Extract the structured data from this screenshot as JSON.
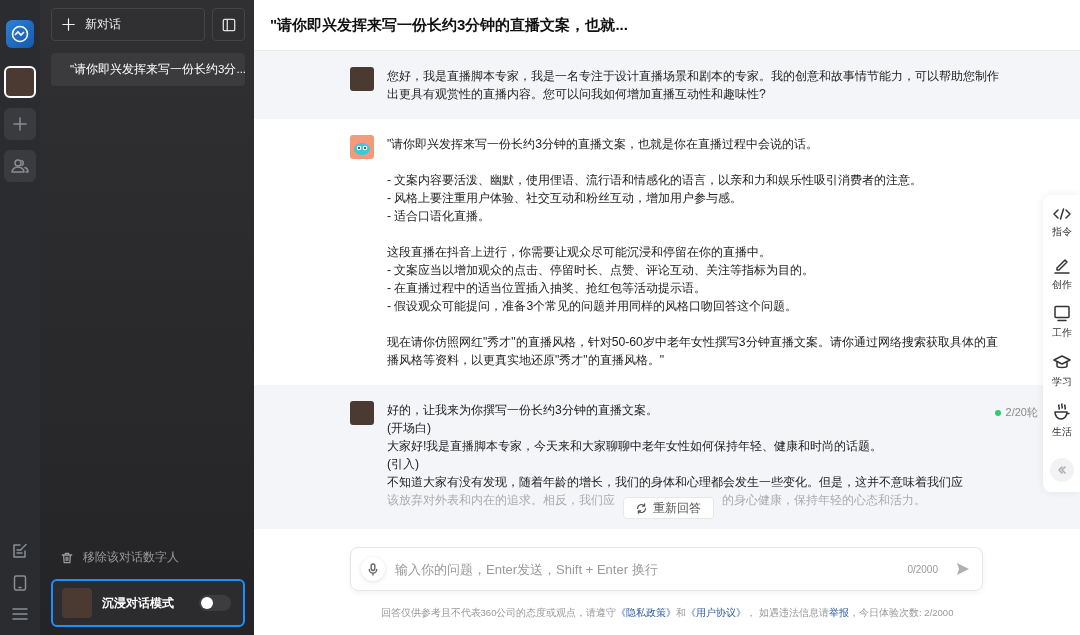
{
  "rail": {
    "items": [
      {
        "kind": "avatar",
        "selected": true
      },
      {
        "kind": "add",
        "selected": false
      },
      {
        "kind": "group",
        "selected": false
      }
    ],
    "bottom": [
      {
        "kind": "note"
      },
      {
        "kind": "tablet"
      },
      {
        "kind": "menu"
      }
    ]
  },
  "sidebar": {
    "new_chat": "新对话",
    "conversations": [
      {
        "title": "\"请你即兴发挥来写一份长约3分...",
        "selected": true
      }
    ],
    "remove": "移除该对话数字人",
    "immersive": {
      "label": "沉浸对话模式",
      "on": false
    }
  },
  "chat": {
    "title": "\"请你即兴发挥来写一份长约3分钟的直播文案，也就...",
    "messages": [
      {
        "kind": "expert",
        "paragraphs": [
          [
            "您好，我是直播脚本专家，我是一名专注于设计直播场景和剧本的专家。我的创意和故事情节能力，可以帮助您制作出更具有观赏性的直播内容。您可以问我如何增加直播互动性和趣味性?"
          ]
        ]
      },
      {
        "kind": "user",
        "paragraphs": [
          [
            "\"请你即兴发挥来写一份长约3分钟的直播文案，也就是你在直播过程中会说的话。"
          ],
          [
            "- 文案内容要活泼、幽默，使用俚语、流行语和情感化的语言，以亲和力和娱乐性吸引消费者的注意。",
            "- 风格上要注重用户体验、社交互动和粉丝互动，增加用户参与感。",
            "- 适合口语化直播。"
          ],
          [
            "这段直播在抖音上进行，你需要让观众尽可能沉浸和停留在你的直播中。",
            "- 文案应当以增加观众的点击、停留时长、点赞、评论互动、关注等指标为目的。",
            "- 在直播过程中的适当位置插入抽奖、抢红包等活动提示语。",
            "- 假设观众可能提问，准备3个常见的问题并用同样的风格口吻回答这个问题。"
          ],
          [
            "现在请你仿照网红\"秀才\"的直播风格，针对50-60岁中老年女性撰写3分钟直播文案。请你通过网络搜索获取具体的直播风格等资料，以更真实地还原\"秀才\"的直播风格。\""
          ]
        ]
      },
      {
        "kind": "expert",
        "rounds": "2/20轮",
        "paragraphs": [
          [
            "好的，让我来为你撰写一份长约3分钟的直播文案。",
            "(开场白)",
            "大家好!我是直播脚本专家，今天来和大家聊聊中老年女性如何保持年轻、健康和时尚的话题。",
            "(引入)",
            "不知道大家有没有发现，随着年龄的增长，我们的身体和心理都会发生一些变化。但是，这并不意味着我们应"
          ]
        ],
        "faded": [
          "该放弃对外表和内在的追求。相反，我们应",
          "的身心健康，保持年轻的心态和活力。"
        ]
      }
    ],
    "regenerate": "重新回答",
    "input": {
      "placeholder": "输入你的问题，Enter发送，Shift + Enter 换行",
      "counter": "0/2000"
    },
    "footer": [
      {
        "kind": "text",
        "text": "回答仅供参考且不代表360公司的态度或观点，请遵守"
      },
      {
        "kind": "link",
        "text": "《隐私政策》"
      },
      {
        "kind": "text",
        "text": "和"
      },
      {
        "kind": "link",
        "text": "《用户协议》"
      },
      {
        "kind": "text",
        "text": "， 如遇违法信息请"
      },
      {
        "kind": "link",
        "text": "举报"
      },
      {
        "kind": "text",
        "text": "，今日体验次数: 2/2000"
      }
    ]
  },
  "tools": [
    {
      "kind": "command",
      "label": "指令"
    },
    {
      "kind": "create",
      "label": "创作"
    },
    {
      "kind": "work",
      "label": "工作"
    },
    {
      "kind": "study",
      "label": "学习"
    },
    {
      "kind": "life",
      "label": "生活"
    }
  ]
}
